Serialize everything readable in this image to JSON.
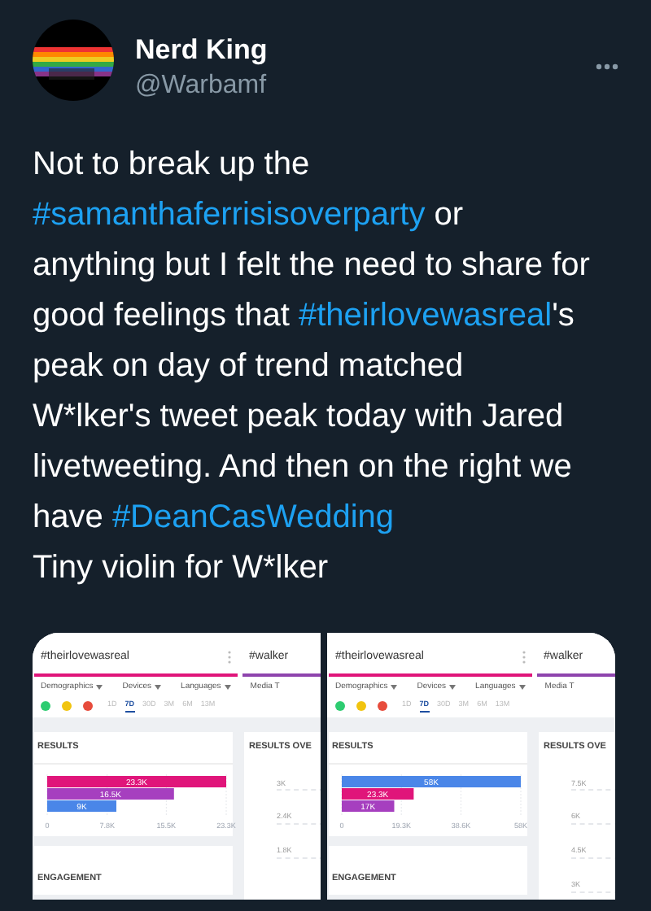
{
  "author": {
    "name": "Nerd King",
    "handle": "@Warbamf"
  },
  "lines": [
    [
      {
        "kind": "text",
        "text": "Not to break up the"
      }
    ],
    [
      {
        "kind": "hashtag",
        "text": "#samanthaferrisisoverparty"
      },
      {
        "kind": "text",
        "text": " or"
      }
    ],
    [
      {
        "kind": "text",
        "text": "anything but I felt the need to share for"
      }
    ],
    [
      {
        "kind": "text",
        "text": "good feelings that "
      },
      {
        "kind": "hashtag",
        "text": "#theirlovewasreal"
      },
      {
        "kind": "text",
        "text": "'s"
      }
    ],
    [
      {
        "kind": "text",
        "text": "peak on day of trend matched"
      }
    ],
    [
      {
        "kind": "text",
        "text": "W*lker's tweet peak today with Jared"
      }
    ],
    [
      {
        "kind": "text",
        "text": "livetweeting. And then on the right we"
      }
    ],
    [
      {
        "kind": "text",
        "text": "have "
      },
      {
        "kind": "hashtag",
        "text": "#DeanCasWedding"
      }
    ],
    [
      {
        "kind": "text",
        "text": "Tiny violin for W*lker"
      }
    ]
  ],
  "screenshots": [
    {
      "tabs": [
        {
          "label": "#theirlovewasreal",
          "color": "#e0157a"
        },
        {
          "label": "#walker",
          "color": "#8e44ad"
        }
      ],
      "filters": [
        "Demographics",
        "Devices",
        "Languages",
        "Media T"
      ],
      "sentiments": [
        {
          "color": "#2ecc71"
        },
        {
          "color": "#f1c40f"
        },
        {
          "color": "#e74c3c"
        }
      ],
      "ranges": [
        {
          "label": "1D",
          "selected": false
        },
        {
          "label": "7D",
          "selected": true
        },
        {
          "label": "30D",
          "selected": false
        },
        {
          "label": "3M",
          "selected": false
        },
        {
          "label": "6M",
          "selected": false
        },
        {
          "label": "13M",
          "selected": false
        }
      ],
      "results": {
        "title": "RESULTS",
        "chart_data": {
          "type": "bar",
          "orientation": "horizontal",
          "series": [
            {
              "color": "#e0157a",
              "values": [
                23300
              ]
            },
            {
              "color": "#a63fbf",
              "values": [
                16500
              ]
            },
            {
              "color": "#4a86e8",
              "values": [
                9000
              ]
            }
          ],
          "xlim": [
            0,
            23300
          ],
          "xticks": [
            {
              "value": 0,
              "label": "0"
            },
            {
              "value": 7800,
              "label": "7.8K"
            },
            {
              "value": 15500,
              "label": "15.5K"
            },
            {
              "value": 23300,
              "label": "23.3K"
            }
          ],
          "value_labels": [
            "23.3K",
            "16.5K",
            "9K"
          ]
        }
      },
      "results_over": {
        "title": "RESULTS OVE",
        "y_labels": [
          "3K",
          "2.4K",
          "1.8K"
        ]
      },
      "engagement": {
        "title": "ENGAGEMENT"
      }
    },
    {
      "tabs": [
        {
          "label": "#theirlovewasreal",
          "color": "#e0157a"
        },
        {
          "label": "#walker",
          "color": "#8e44ad"
        }
      ],
      "filters": [
        "Demographics",
        "Devices",
        "Languages",
        "Media T"
      ],
      "sentiments": [
        {
          "color": "#2ecc71"
        },
        {
          "color": "#f1c40f"
        },
        {
          "color": "#e74c3c"
        }
      ],
      "ranges": [
        {
          "label": "1D",
          "selected": false
        },
        {
          "label": "7D",
          "selected": true
        },
        {
          "label": "30D",
          "selected": false
        },
        {
          "label": "3M",
          "selected": false
        },
        {
          "label": "6M",
          "selected": false
        },
        {
          "label": "13M",
          "selected": false
        }
      ],
      "results": {
        "title": "RESULTS",
        "chart_data": {
          "type": "bar",
          "orientation": "horizontal",
          "series": [
            {
              "color": "#4a86e8",
              "values": [
                58000
              ]
            },
            {
              "color": "#e0157a",
              "values": [
                23300
              ]
            },
            {
              "color": "#a63fbf",
              "values": [
                17000
              ]
            }
          ],
          "xlim": [
            0,
            58000
          ],
          "xticks": [
            {
              "value": 0,
              "label": "0"
            },
            {
              "value": 19300,
              "label": "19.3K"
            },
            {
              "value": 38600,
              "label": "38.6K"
            },
            {
              "value": 58000,
              "label": "58K"
            }
          ],
          "value_labels": [
            "58K",
            "23.3K",
            "17K"
          ]
        }
      },
      "results_over": {
        "title": "RESULTS OVE",
        "y_labels": [
          "7.5K",
          "6K",
          "4.5K",
          "3K"
        ]
      },
      "engagement": {
        "title": "ENGAGEMENT"
      }
    }
  ]
}
